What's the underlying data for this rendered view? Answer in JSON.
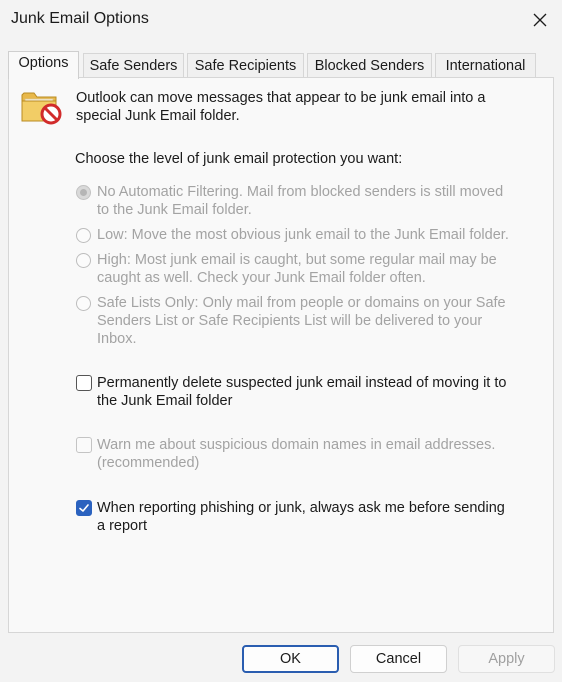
{
  "window": {
    "title": "Junk Email Options"
  },
  "tabs": [
    {
      "label": "Options",
      "active": true
    },
    {
      "label": "Safe Senders"
    },
    {
      "label": "Safe Recipients"
    },
    {
      "label": "Blocked Senders"
    },
    {
      "label": "International"
    }
  ],
  "intro": {
    "line1": "Outlook can move messages that appear to be junk email into a",
    "line2": "special Junk Email folder."
  },
  "protection_prompt": "Choose the level of junk email protection you want:",
  "levels": [
    {
      "lines": [
        "No Automatic Filtering. Mail from blocked senders is still moved",
        "to the Junk Email folder."
      ],
      "selected": true
    },
    {
      "lines": [
        "Low: Move the most obvious junk email to the Junk Email folder."
      ],
      "selected": false
    },
    {
      "lines": [
        "High: Most junk email is caught, but some regular mail may be",
        "caught as well. Check your Junk Email folder often."
      ],
      "selected": false
    },
    {
      "lines": [
        "Safe Lists Only: Only mail from people or domains on your Safe",
        "Senders List or Safe Recipients List will be delivered to your",
        "Inbox."
      ],
      "selected": false
    }
  ],
  "options": {
    "permanently_delete": {
      "lines": [
        "Permanently delete suspected junk email instead of moving it to",
        "the Junk Email folder"
      ],
      "checked": false
    },
    "warn_domains": {
      "lines": [
        "Warn me about suspicious domain names in email addresses.",
        "(recommended)"
      ],
      "checked": false
    },
    "ask_before_sending": {
      "lines": [
        "When reporting phishing or junk, always ask me before sending",
        "a report"
      ],
      "checked": true
    }
  },
  "buttons": {
    "ok": "OK",
    "cancel": "Cancel",
    "apply": "Apply"
  },
  "icons": {
    "close": "close-icon",
    "folder": "junk-folder-icon",
    "check": "checkmark-icon"
  },
  "colors": {
    "accent": "#2b62bf",
    "disabled_text": "#a3a3a3"
  }
}
